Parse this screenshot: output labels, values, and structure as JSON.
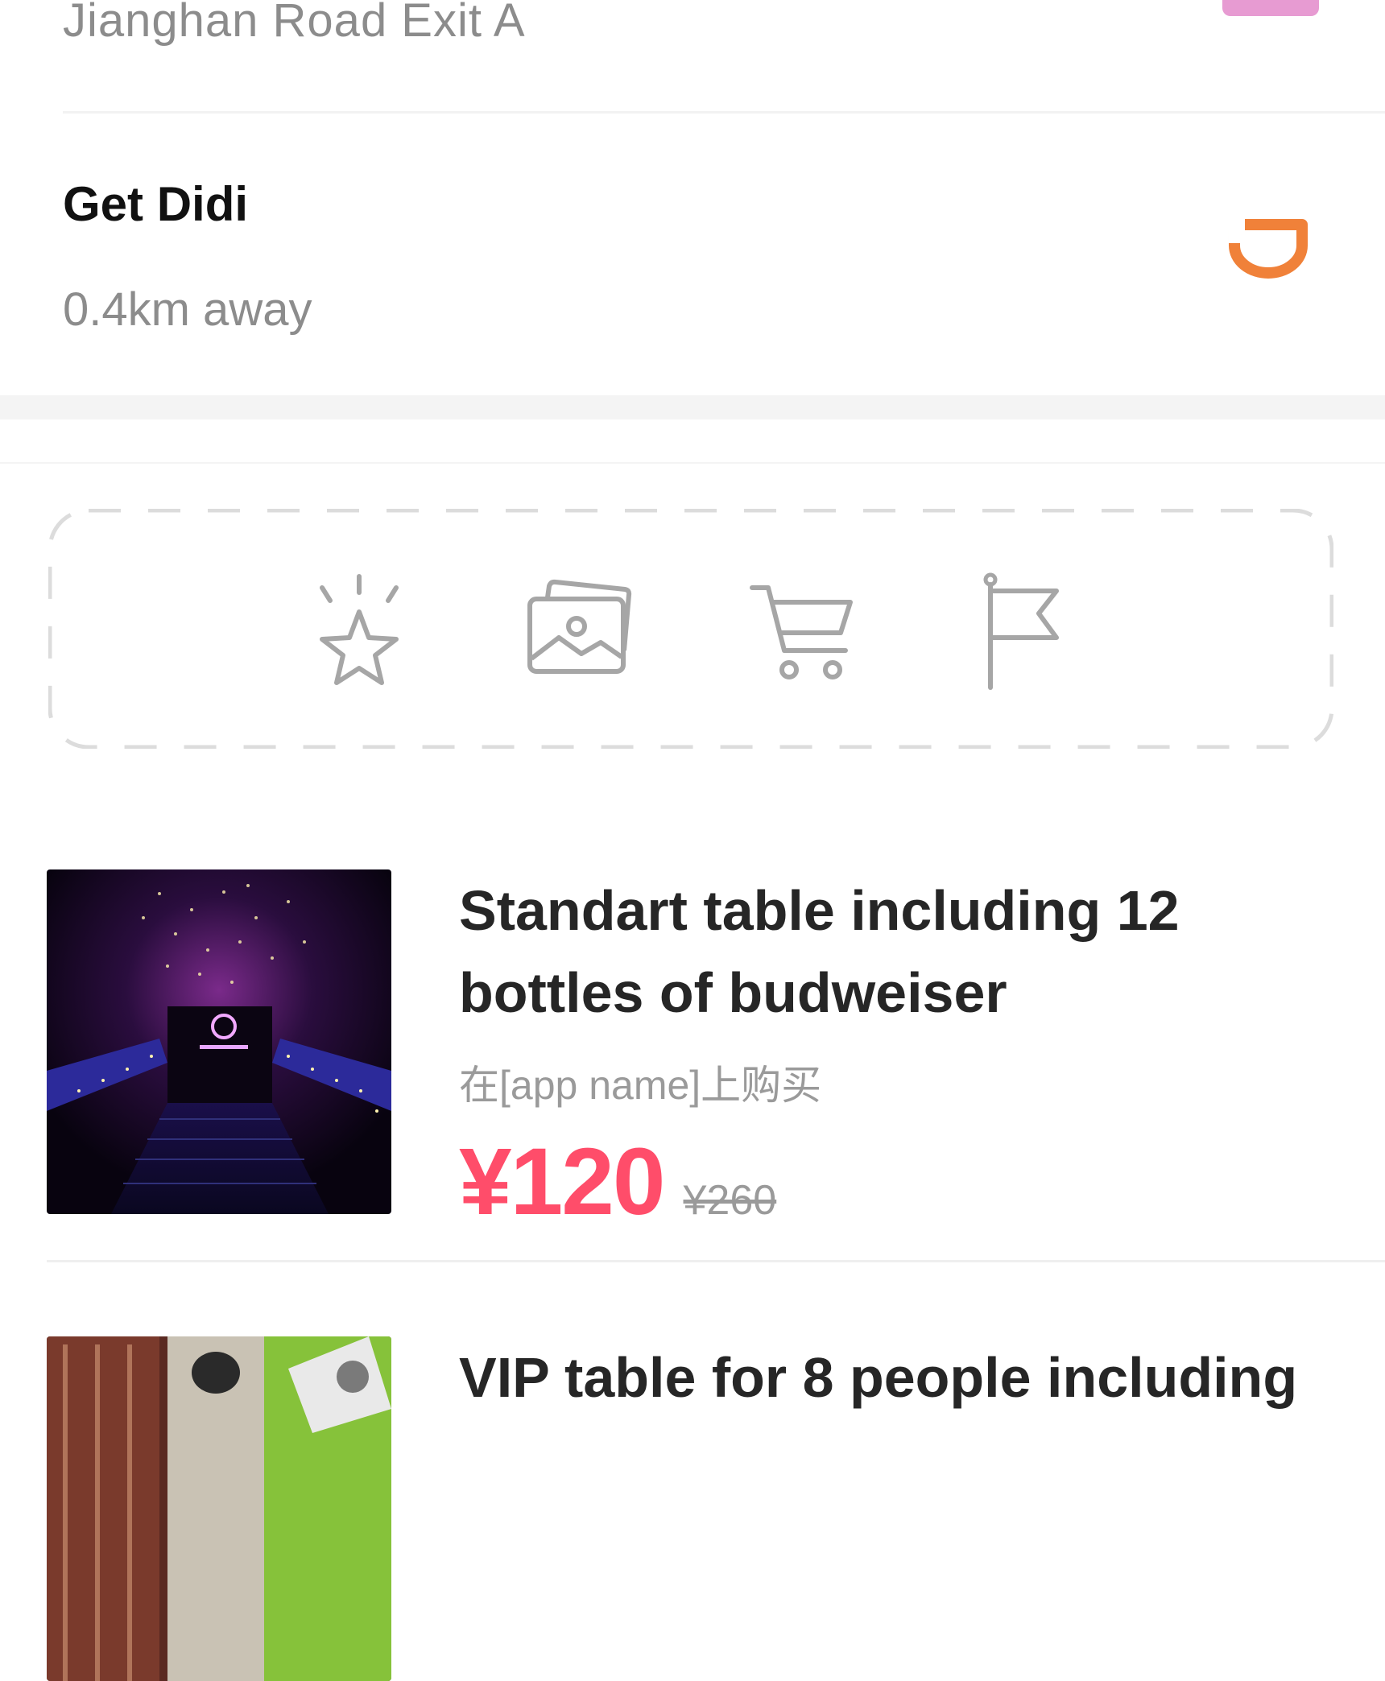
{
  "metro": {
    "subtitle": "Jianghan Road Exit A",
    "badge_color": "#e79bd2"
  },
  "didi": {
    "title": "Get Didi",
    "distance": "0.4km away",
    "icon": "didi-logo-icon",
    "icon_color": "#f08139"
  },
  "actions": [
    {
      "icon": "favorite-star-icon"
    },
    {
      "icon": "photo-gallery-icon"
    },
    {
      "icon": "shopping-cart-icon"
    },
    {
      "icon": "flag-icon"
    }
  ],
  "products": [
    {
      "title": "Standart table including 12 bottles of budweiser",
      "source": "在[app name]上购买",
      "price": "¥120",
      "original_price": "¥260"
    },
    {
      "title": "VIP table for 8 people including"
    }
  ],
  "colors": {
    "accent_price": "#ff4d6a",
    "muted_text": "#8c8c8c",
    "icon_gray": "#a6a6a6"
  }
}
